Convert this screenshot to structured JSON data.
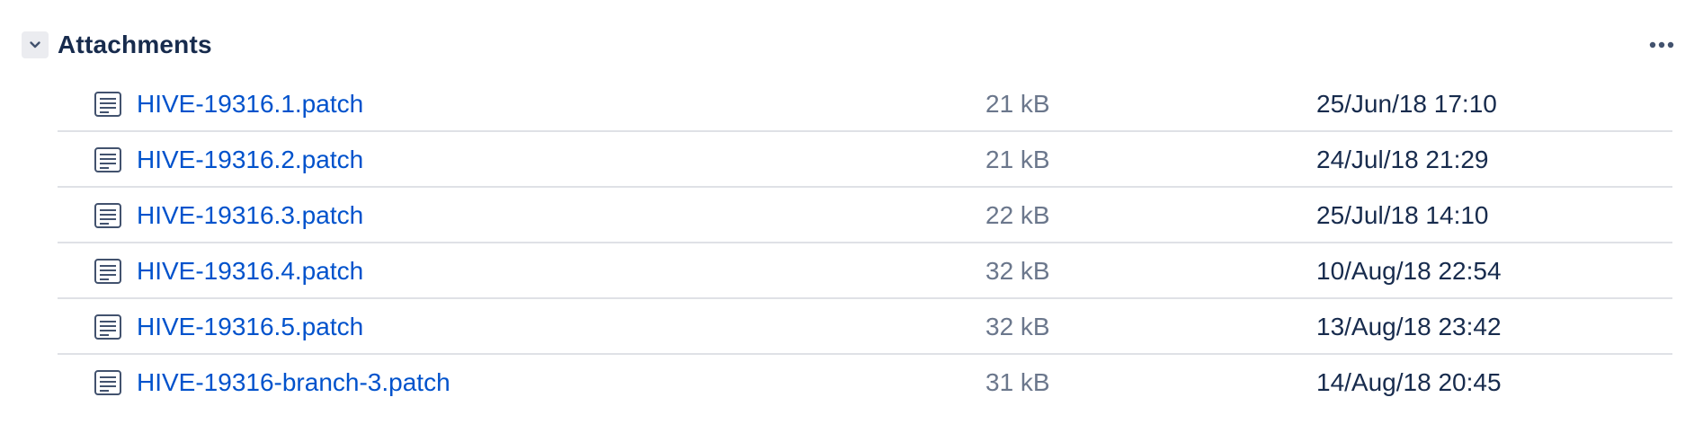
{
  "section": {
    "title": "Attachments",
    "toggle_icon": "chevron-down-icon",
    "more_icon": "more-horizontal-icon"
  },
  "attachments": [
    {
      "name": "HIVE-19316.1.patch",
      "size": "21 kB",
      "date": "25/Jun/18 17:10",
      "icon": "document-icon"
    },
    {
      "name": "HIVE-19316.2.patch",
      "size": "21 kB",
      "date": "24/Jul/18 21:29",
      "icon": "document-icon"
    },
    {
      "name": "HIVE-19316.3.patch",
      "size": "22 kB",
      "date": "25/Jul/18 14:10",
      "icon": "document-icon"
    },
    {
      "name": "HIVE-19316.4.patch",
      "size": "32 kB",
      "date": "10/Aug/18 22:54",
      "icon": "document-icon"
    },
    {
      "name": "HIVE-19316.5.patch",
      "size": "32 kB",
      "date": "13/Aug/18 23:42",
      "icon": "document-icon"
    },
    {
      "name": "HIVE-19316-branch-3.patch",
      "size": "31 kB",
      "date": "14/Aug/18 20:45",
      "icon": "document-icon"
    }
  ],
  "colors": {
    "link": "#0052cc",
    "title": "#172b4d",
    "muted": "#6b778c",
    "divider": "#dfe1e6",
    "toggle_bg": "#ebecf0"
  }
}
